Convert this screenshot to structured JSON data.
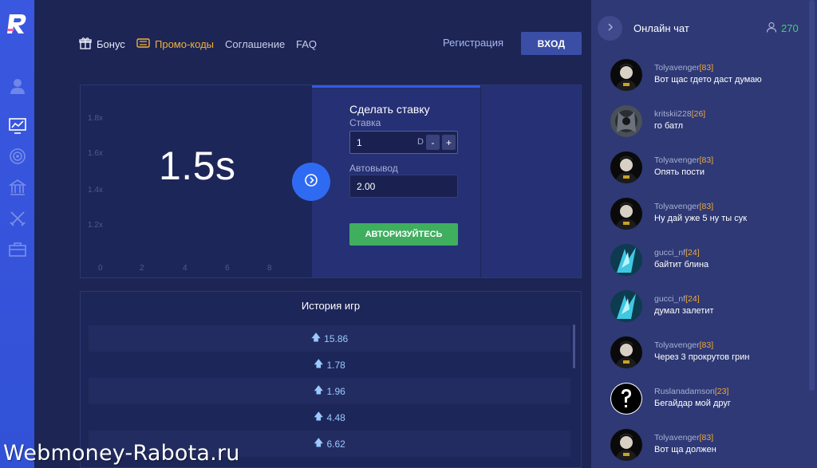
{
  "nav": {
    "bonus": "Бонус",
    "promo": "Промо-коды",
    "agreement": "Соглашение",
    "faq": "FAQ",
    "register": "Регистрация",
    "login": "ВХОД"
  },
  "sidebar": {
    "icons": [
      "user-icon",
      "chart-icon",
      "target-icon",
      "building-icon",
      "crossed-swords-icon",
      "briefcase-icon"
    ]
  },
  "game": {
    "timer": "1.5s",
    "y_ticks": [
      "1.8x",
      "1.6x",
      "1.4x",
      "1.2x"
    ],
    "x_ticks": [
      "0",
      "2",
      "4",
      "6",
      "8"
    ]
  },
  "bet": {
    "title": "Сделать ставку",
    "stake_label": "Ставка",
    "stake_value": "1",
    "currency": "D",
    "minus": "-",
    "plus": "+",
    "autowithdraw_label": "Автовывод",
    "autowithdraw_value": "2.00",
    "auth_button": "АВТОРИЗУЙТЕСЬ"
  },
  "history": {
    "title": "История игр",
    "items": [
      "15.86",
      "1.78",
      "1.96",
      "4.48",
      "6.62"
    ]
  },
  "chat": {
    "title": "Онлайн чат",
    "online": "270",
    "messages": [
      {
        "user": "Tolyavenger",
        "level": "[83]",
        "text": "Вот щас гдето даст думаю"
      },
      {
        "user": "kritskii228",
        "level": "[26]",
        "text": "го батл"
      },
      {
        "user": "Tolyavenger",
        "level": "[83]",
        "text": "Опять пости"
      },
      {
        "user": "Tolyavenger",
        "level": "[83]",
        "text": "Ну дай уже 5 ну ты сук"
      },
      {
        "user": "gucci_nf",
        "level": "[24]",
        "text": "байтит блина"
      },
      {
        "user": "gucci_nf",
        "level": "[24]",
        "text": "думал залетит"
      },
      {
        "user": "Tolyavenger",
        "level": "[83]",
        "text": "Через 3 прокрутов грин"
      },
      {
        "user": "Ruslanadamson",
        "level": "[23]",
        "text": "Бегайдар мой друг"
      },
      {
        "user": "Tolyavenger",
        "level": "[83]",
        "text": "Вот ща должен"
      }
    ]
  },
  "watermark": "Webmoney-Rabota.ru",
  "colors": {
    "background": "#1c2554",
    "sidebar": "#3151d6",
    "accent_orange": "#f1b03b",
    "green": "#3fae5f",
    "online_green": "#3fcf7a",
    "play_blue": "#2f6bf2"
  }
}
